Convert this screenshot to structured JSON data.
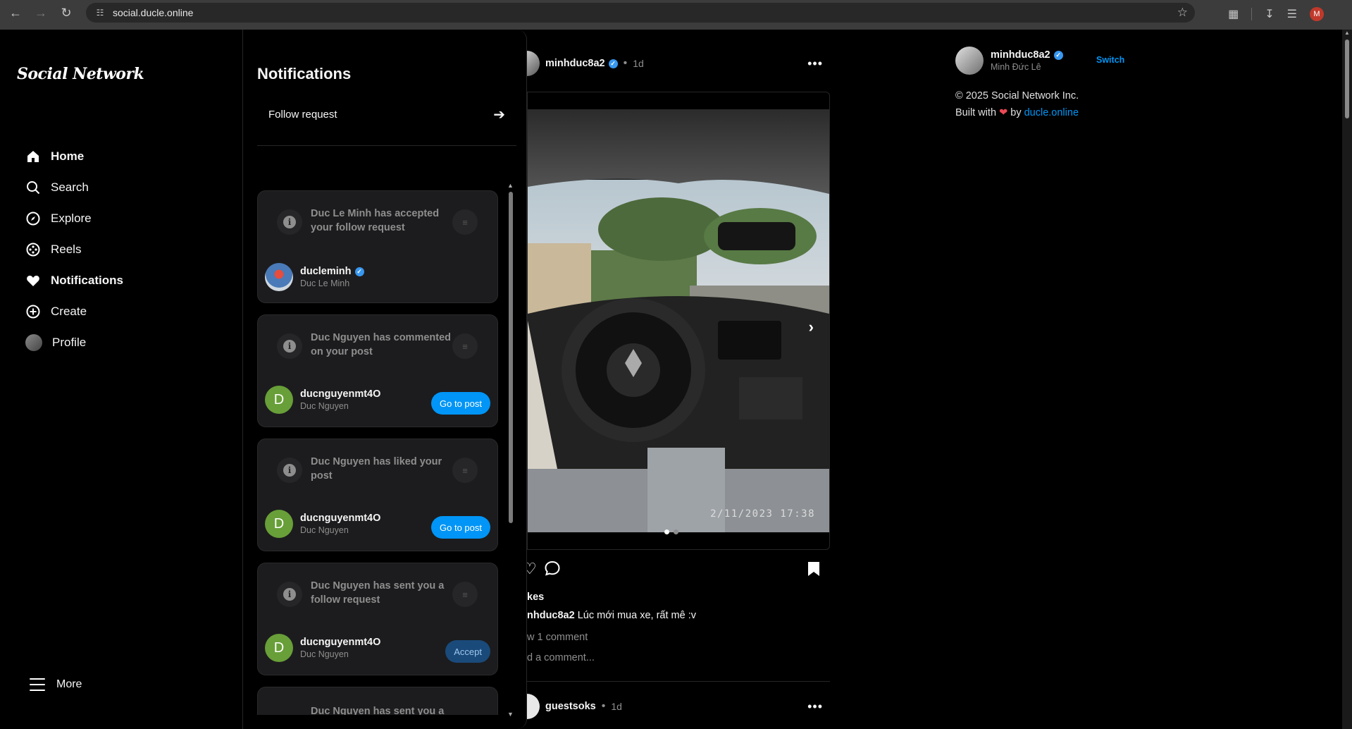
{
  "browser": {
    "url": "social.ducle.online",
    "profile_initial": "M"
  },
  "nav": {
    "logo": "Social Network",
    "items": [
      {
        "label": "Home",
        "icon": "home-icon"
      },
      {
        "label": "Search",
        "icon": "search-icon"
      },
      {
        "label": "Explore",
        "icon": "compass-icon"
      },
      {
        "label": "Reels",
        "icon": "reels-icon"
      },
      {
        "label": "Notifications",
        "icon": "heart-icon"
      },
      {
        "label": "Create",
        "icon": "plus-circle-icon"
      },
      {
        "label": "Profile",
        "icon": "avatar"
      }
    ],
    "more_label": "More"
  },
  "notifications": {
    "title": "Notifications",
    "follow_request_label": "Follow request",
    "items": [
      {
        "message": "Duc Le Minh has accepted your follow request",
        "username": "ducleminh",
        "fullname": "Duc Le Minh",
        "verified": true,
        "action": ""
      },
      {
        "message": "Duc Nguyen has commented on your post",
        "username": "ducnguyenmt4O",
        "fullname": "Duc Nguyen",
        "avatar_letter": "D",
        "action": "Go to post"
      },
      {
        "message": "Duc Nguyen has liked your post",
        "username": "ducnguyenmt4O",
        "fullname": "Duc Nguyen",
        "avatar_letter": "D",
        "action": "Go to post"
      },
      {
        "message": "Duc Nguyen has sent you a follow request",
        "username": "ducnguyenmt4O",
        "fullname": "Duc Nguyen",
        "avatar_letter": "D",
        "action": "Accept"
      },
      {
        "message": "Duc Nguyen has sent you a"
      }
    ]
  },
  "feed": {
    "post": {
      "username": "minhduc8a2",
      "time": "1d",
      "photo_timestamp": "2/11/2023 17:38",
      "likes_partial": "kes",
      "caption_user_partial": "nhduc8a2",
      "caption_text": "Lúc mới mua xe, rất mê :v",
      "view_comments_partial": "w 1 comment",
      "add_comment_partial": "d a comment..."
    },
    "post2": {
      "username": "guestsoks",
      "time": "1d"
    }
  },
  "sidebar_right": {
    "username": "minhduc8a2",
    "fullname": "Minh Đức Lê",
    "switch_label": "Switch",
    "copyright": "© 2025 Social Network Inc.",
    "built_with": "Built with",
    "by": "by",
    "link": "ducle.online"
  },
  "colors": {
    "accent": "#0095f6",
    "verified": "#3897f0",
    "heart": "#ed4956"
  }
}
